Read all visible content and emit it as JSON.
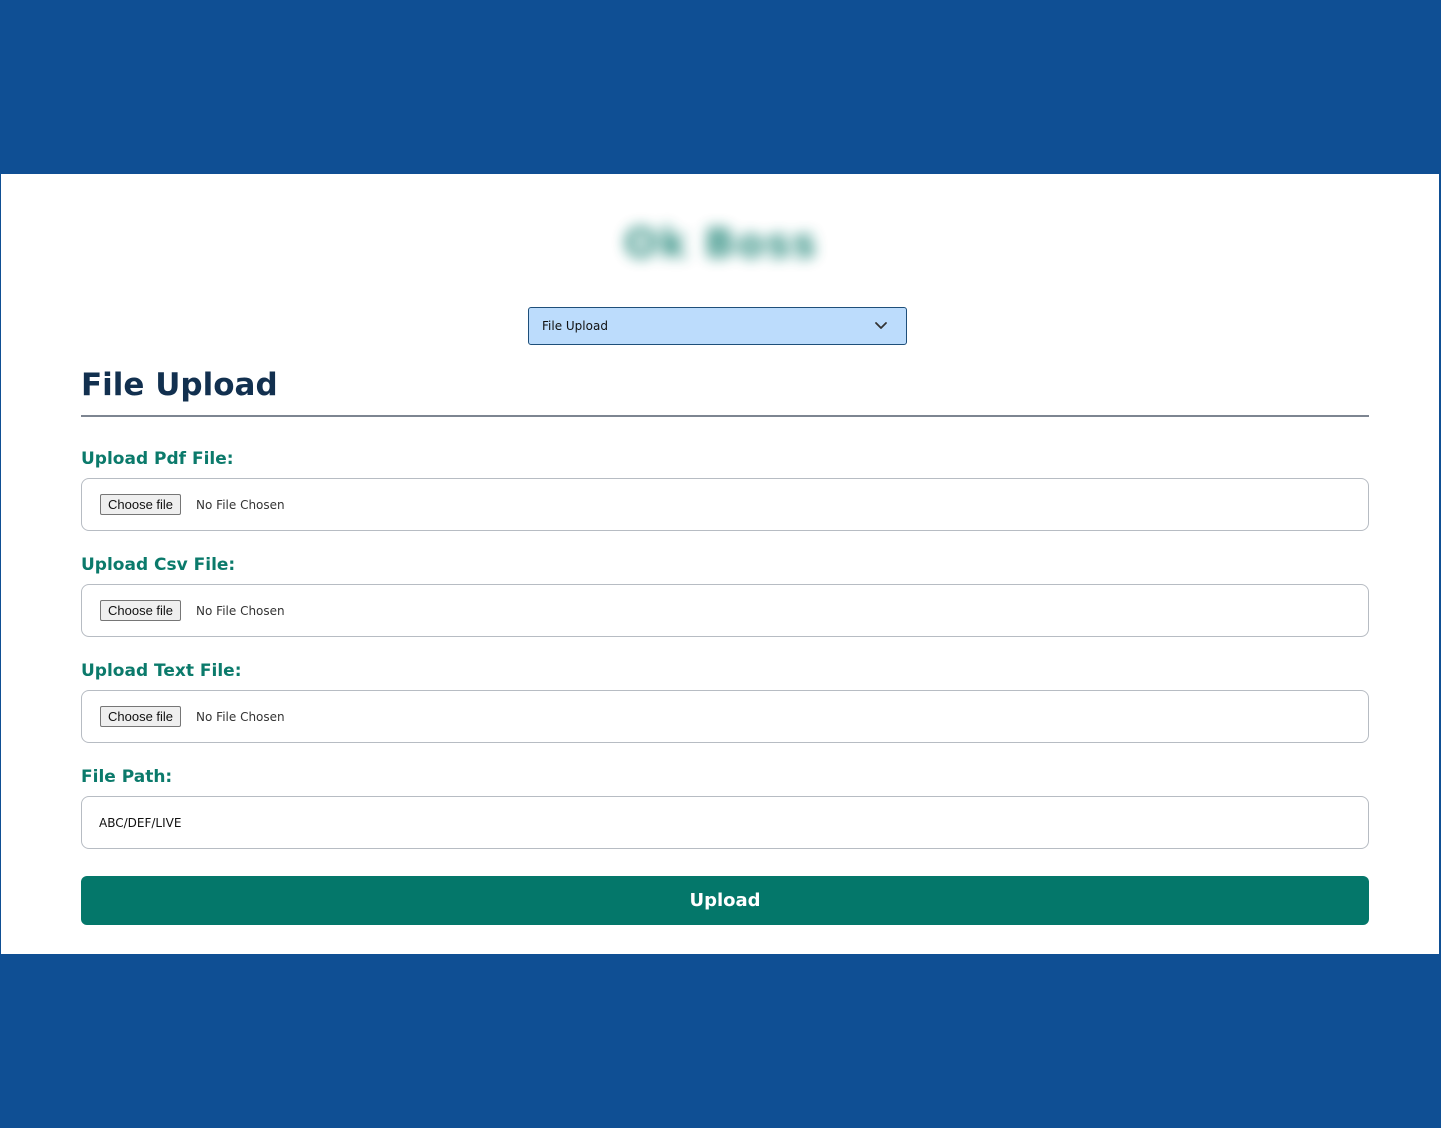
{
  "colors": {
    "frame_blue": "#0f4f94",
    "accent_teal": "#04776a",
    "label_teal": "#0b7a6b",
    "title_navy": "#12304f",
    "select_bg": "#bcdcfc"
  },
  "header": {
    "logo_text": "Ok Boss"
  },
  "selector": {
    "value": "File Upload",
    "icon": "chevron-down-icon"
  },
  "page": {
    "title": "File Upload"
  },
  "form": {
    "pdf": {
      "label": "Upload Pdf File:",
      "button": "Choose file",
      "status": "No File Chosen"
    },
    "csv": {
      "label": "Upload Csv File:",
      "button": "Choose file",
      "status": "No File Chosen"
    },
    "text": {
      "label": "Upload Text File:",
      "button": "Choose file",
      "status": "No File Chosen"
    },
    "path": {
      "label": "File Path:",
      "value": "ABC/DEF/LIVE"
    },
    "submit_label": "Upload"
  }
}
